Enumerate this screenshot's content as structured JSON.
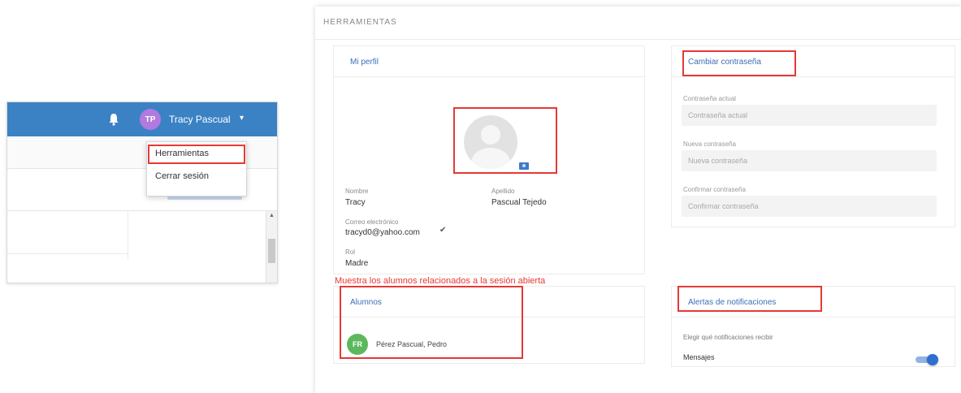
{
  "header": {
    "avatar_initials": "TP",
    "user_name": "Tracy Pascual",
    "accent_color": "#3b82c4"
  },
  "user_menu": {
    "items": [
      "Herramientas",
      "Cerrar sesión"
    ]
  },
  "page": {
    "title": "HERRAMIENTAS"
  },
  "profile_card": {
    "title": "Mi perfil",
    "name_label": "Nombre",
    "name_value": "Tracy",
    "surname_label": "Apellido",
    "surname_value": "Pascual Tejedo",
    "email_label": "Correo electrónico",
    "email_value": "tracyd0@yahoo.com",
    "role_label": "Rol",
    "role_value": "Madre"
  },
  "password_card": {
    "title": "Cambiar contraseña",
    "current_label": "Contraseña actual",
    "current_placeholder": "Contraseña actual",
    "new_label": "Nueva contraseña",
    "new_placeholder": "Nueva contraseña",
    "confirm_label": "Confirmar contraseña",
    "confirm_placeholder": "Confirmar contraseña"
  },
  "annotation": {
    "text": "Muestra los alumnos relacionados a la sesión abierta"
  },
  "students_card": {
    "title": "Alumnos",
    "items": [
      {
        "initials": "FR",
        "name": "Pérez Pascual, Pedro"
      }
    ]
  },
  "notifications_card": {
    "title": "Alertas de notificaciones",
    "description": "Elegir qué notificaciones recibir",
    "option_label": "Mensajes",
    "toggle_on": true
  }
}
